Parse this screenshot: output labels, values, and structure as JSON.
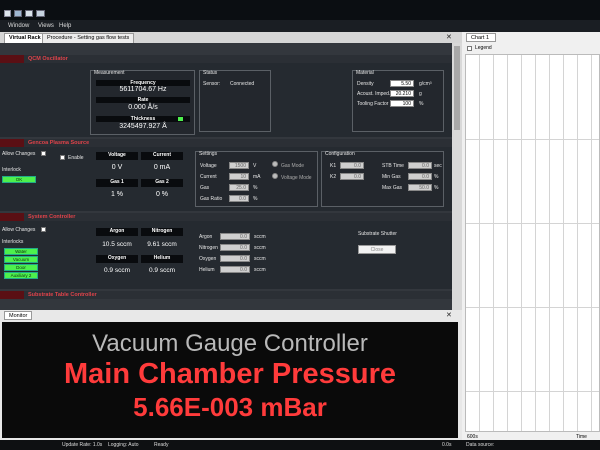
{
  "menu": {
    "items": [
      "Window",
      "Views",
      "Help"
    ]
  },
  "tabs": {
    "virtual_rack": "Virtual Rack",
    "procedure": "Procedure - Setting gas flow tests"
  },
  "qcm": {
    "title": "QCM Oscillator",
    "measurement_title": "Measurement",
    "frequency_label": "Frequency",
    "frequency_value": "5611704.67  Hz",
    "rate_label": "Rate",
    "rate_value": "0.000  Å/s",
    "thickness_label": "Thickness",
    "thickness_value": "3245497.927  Å",
    "status_title": "Status",
    "sensor_label": "Sensor:",
    "sensor_value": "Connected",
    "material_title": "Material",
    "density_label": "Density",
    "density_value": "5.50",
    "density_unit": "g/cm³",
    "acoustic_label": "Acoust. Imped.",
    "acoustic_value": "20.210",
    "acoustic_unit": "g",
    "tooling_label": "Tooling Factor",
    "tooling_value": "100",
    "tooling_unit": "%"
  },
  "plasma": {
    "title": "Gencoa Plasma Source",
    "allow_changes": "Allow Changes",
    "enable": "Enable",
    "interlock": "Interlock",
    "ok": "OK",
    "voltage_label": "Voltage",
    "voltage_value": "0 V",
    "current_label": "Current",
    "current_value": "0 mA",
    "gas1_label": "Gas 1",
    "gas1_value": "1 %",
    "gas2_label": "Gas 2",
    "gas2_value": "0 %",
    "settings_title": "Settings",
    "set_voltage": "Voltage",
    "set_voltage_val": "1500",
    "set_voltage_unit": "V",
    "set_current": "Current",
    "set_current_val": "10",
    "set_current_unit": "mA",
    "set_gas": "Gas",
    "set_gas_val": "25.0",
    "set_gas_unit": "%",
    "set_gasratio": "Gas Ratio",
    "set_gasratio_val": "0.0",
    "set_gasratio_unit": "%",
    "gas_mode": "Gas Mode",
    "voltage_mode": "Voltage Mode",
    "config_title": "Configuration",
    "k1_label": "K1",
    "k1_val": "0.0",
    "k2_label": "K2",
    "k2_val": "0.0",
    "stb_label": "STB Time",
    "stb_val": "0.0",
    "stb_unit": "sec",
    "mingas_label": "Min Gas",
    "mingas_val": "0.0",
    "mingas_unit": "%",
    "maxgas_label": "Max Gas",
    "maxgas_val": "50.0",
    "maxgas_unit": "%"
  },
  "system": {
    "title": "System Controller",
    "allow_changes": "Allow Changes",
    "interlocks": "Interlocks",
    "interlock_items": [
      "Water",
      "Vacuum",
      "Door",
      "Auxiliary 2"
    ],
    "argon_label": "Argon",
    "argon_value": "10.5 sccm",
    "nitrogen_label": "Nitrogen",
    "nitrogen_value": "9.61 sccm",
    "oxygen_label": "Oxygen",
    "oxygen_value": "0.9 sccm",
    "helium_label": "Helium",
    "helium_value": "0.9 sccm",
    "set_argon": "Argon",
    "set_nitrogen": "Nitrogen",
    "set_oxygen": "Oxygen",
    "set_helium": "Helium",
    "set_val": "0.0",
    "set_unit": "sccm",
    "shutter_title": "Substrate Shutter",
    "shutter_button": "Close"
  },
  "substrate": {
    "title": "Substrate Table Controller"
  },
  "monitor": {
    "tab": "Monitor",
    "line1": "Vacuum Gauge Controller",
    "line2": "Main Chamber Pressure",
    "line3": "5.66E-003 mBar"
  },
  "chart": {
    "tab": "Chart 1",
    "legend": "Legend",
    "x_start": "600s",
    "x_label": "Time",
    "x_end": "0.0s"
  },
  "status": {
    "update_rate": "Update Rate: 1.0s",
    "logging": "Logging: Auto",
    "ready": "Ready",
    "data_source": "Data source:"
  },
  "colors": {
    "accent_red": "#e0434a",
    "led_green": "#4df04d",
    "pressure_red": "#ff3b3b"
  }
}
